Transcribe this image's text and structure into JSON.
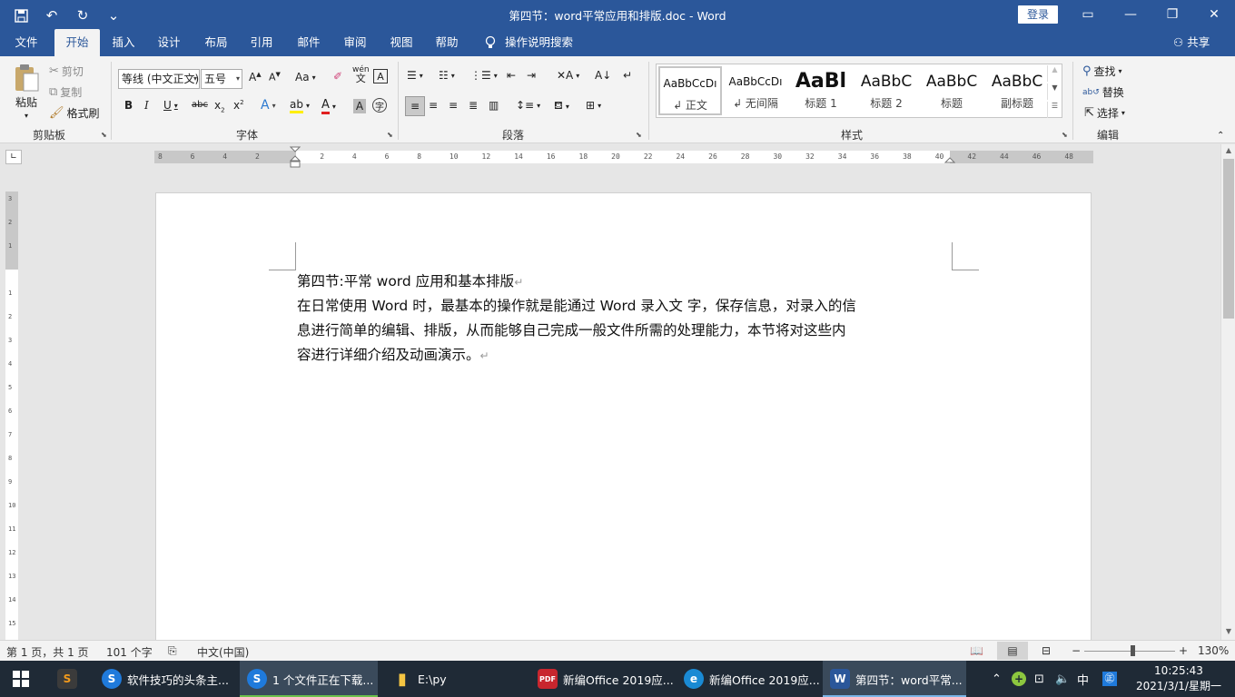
{
  "window": {
    "title": "第四节：word平常应用和排版.doc  -  Word",
    "login_label": "登录",
    "qat_customize": "⌄"
  },
  "tabs": [
    {
      "label": "文件"
    },
    {
      "label": "开始"
    },
    {
      "label": "插入"
    },
    {
      "label": "设计"
    },
    {
      "label": "布局"
    },
    {
      "label": "引用"
    },
    {
      "label": "邮件"
    },
    {
      "label": "审阅"
    },
    {
      "label": "视图"
    },
    {
      "label": "帮助"
    }
  ],
  "tell_me": "操作说明搜索",
  "share_label": "共享",
  "ribbon": {
    "clipboard": {
      "label": "剪贴板",
      "paste": "粘贴",
      "cut": "剪切",
      "copy": "复制",
      "format_painter": "格式刷"
    },
    "font": {
      "label": "字体",
      "font_name": "等线 (中文正文)",
      "font_size": "五号",
      "phonetic": "wén"
    },
    "paragraph": {
      "label": "段落"
    },
    "styles": {
      "label": "样式",
      "items": [
        {
          "preview": "AaBbCcDı",
          "name": "↲ 正文"
        },
        {
          "preview": "AaBbCcDı",
          "name": "↲ 无间隔"
        },
        {
          "preview": "AaBl",
          "name": "标题 1"
        },
        {
          "preview": "AaBbC",
          "name": "标题 2"
        },
        {
          "preview": "AaBbC",
          "name": "标题"
        },
        {
          "preview": "AaBbC",
          "name": "副标题"
        }
      ]
    },
    "editing": {
      "label": "编辑",
      "find": "查找",
      "replace": "替换",
      "select": "选择"
    }
  },
  "ruler": {
    "ticks": [
      "8",
      "6",
      "4",
      "2",
      "",
      "2",
      "4",
      "6",
      "8",
      "10",
      "12",
      "14",
      "16",
      "18",
      "20",
      "22",
      "24",
      "26",
      "28",
      "30",
      "32",
      "34",
      "36",
      "38",
      "40",
      "42",
      "44",
      "46",
      "48"
    ],
    "vticks": [
      "3",
      "2",
      "1",
      "",
      "1",
      "2",
      "3",
      "4",
      "5",
      "6",
      "7",
      "8",
      "9",
      "10",
      "11",
      "12",
      "13",
      "14",
      "15"
    ]
  },
  "document": {
    "heading": "第四节:平常 word 应用和基本排版",
    "paragraph_lines": [
      "在日常使用 Word 时，最基本的操作就是能通过 Word 录入文  字，保存信息，对录入的信",
      "息进行简单的编辑、排版，从而能够自己完成一般文件所需的处理能力，本节将对这些内",
      "容进行详细介绍及动画演示。"
    ],
    "pilcrow": "↵"
  },
  "status": {
    "page": "第 1 页，共 1 页",
    "words": "101 个字",
    "language": "中文(中国)",
    "zoom": "130%",
    "zoom_minus": "−",
    "zoom_plus": "+"
  },
  "taskbar": {
    "items": [
      {
        "label": "软件技巧的头条主..."
      },
      {
        "label": "1 个文件正在下载..."
      },
      {
        "label": "E:\\py"
      },
      {
        "label": "新编Office 2019应..."
      },
      {
        "label": "新编Office 2019应..."
      },
      {
        "label": "第四节：word平常..."
      }
    ],
    "ime": "中",
    "time": "10:25:43",
    "date": "2021/3/1/星期一"
  }
}
